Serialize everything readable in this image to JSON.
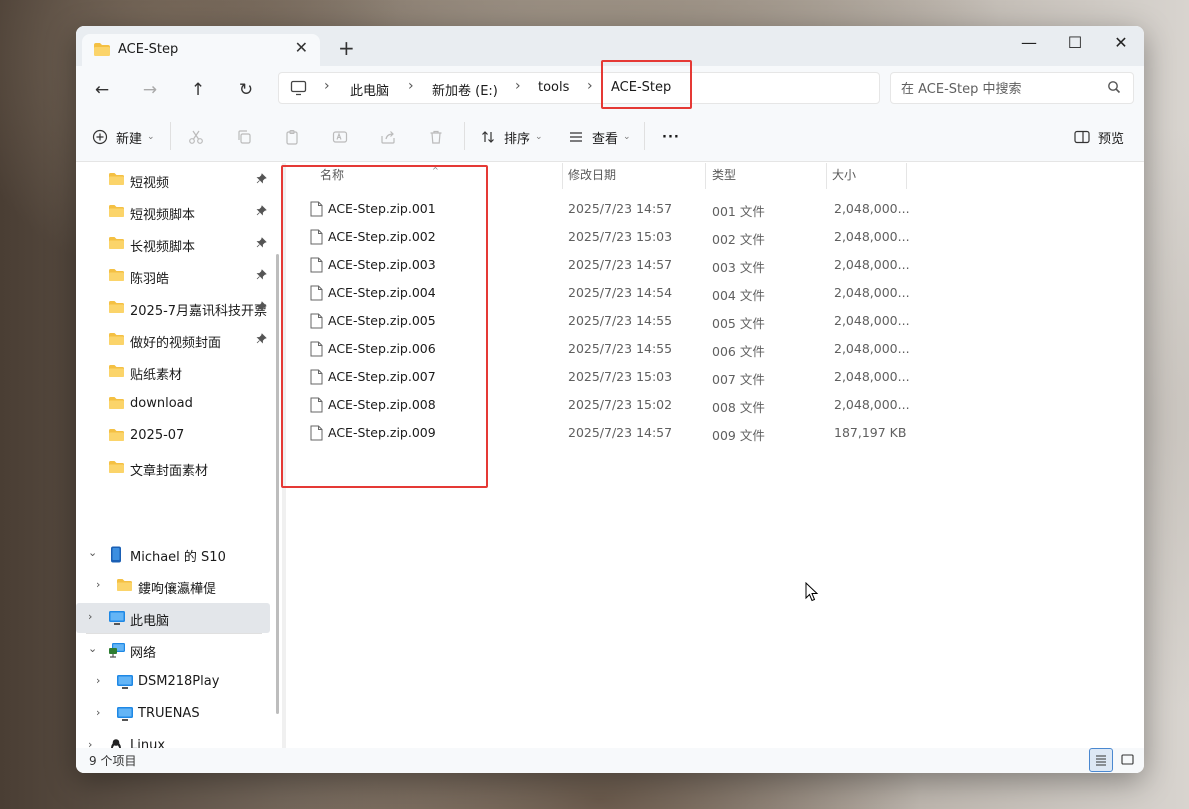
{
  "window": {
    "tab_title": "ACE-Step",
    "new_tab": "+",
    "close_tab": "✕",
    "minimize": "—",
    "maximize": "☐",
    "close": "✕"
  },
  "nav": {
    "back": "←",
    "forward": "→",
    "up": "↑",
    "refresh": "↻",
    "breadcrumb": [
      "此电脑",
      "新加卷 (E:)",
      "tools",
      "ACE-Step"
    ],
    "search_placeholder": "在 ACE-Step 中搜索"
  },
  "toolbar": {
    "new_label": "新建",
    "sort_label": "排序",
    "view_label": "查看",
    "more_label": "···",
    "preview_label": "预览"
  },
  "sidebar": {
    "quick_access": [
      {
        "label": "短视频",
        "pinned": true
      },
      {
        "label": "短视频脚本",
        "pinned": true
      },
      {
        "label": "长视频脚本",
        "pinned": true
      },
      {
        "label": "陈羽皓",
        "pinned": true
      },
      {
        "label": "2025-7月嘉讯科技开票",
        "pinned": true
      },
      {
        "label": "做好的视频封面",
        "pinned": true
      },
      {
        "label": "贴纸素材",
        "pinned": false
      },
      {
        "label": "download",
        "pinned": false
      },
      {
        "label": "2025-07",
        "pinned": false
      },
      {
        "label": "文章封面素材",
        "pinned": false
      }
    ],
    "device": "Michael 的 S10",
    "device_child": "鏤呴儴瀛樺偍",
    "this_pc": "此电脑",
    "network": "网络",
    "network_items": [
      "DSM218Play",
      "TRUENAS"
    ],
    "linux": "Linux"
  },
  "columns": {
    "name": "名称",
    "date": "修改日期",
    "type": "类型",
    "size": "大小"
  },
  "files": [
    {
      "name": "ACE-Step.zip.001",
      "date": "2025/7/23 14:57",
      "type": "001 文件",
      "size": "2,048,000..."
    },
    {
      "name": "ACE-Step.zip.002",
      "date": "2025/7/23 15:03",
      "type": "002 文件",
      "size": "2,048,000..."
    },
    {
      "name": "ACE-Step.zip.003",
      "date": "2025/7/23 14:57",
      "type": "003 文件",
      "size": "2,048,000..."
    },
    {
      "name": "ACE-Step.zip.004",
      "date": "2025/7/23 14:54",
      "type": "004 文件",
      "size": "2,048,000..."
    },
    {
      "name": "ACE-Step.zip.005",
      "date": "2025/7/23 14:55",
      "type": "005 文件",
      "size": "2,048,000..."
    },
    {
      "name": "ACE-Step.zip.006",
      "date": "2025/7/23 14:55",
      "type": "006 文件",
      "size": "2,048,000..."
    },
    {
      "name": "ACE-Step.zip.007",
      "date": "2025/7/23 15:03",
      "type": "007 文件",
      "size": "2,048,000..."
    },
    {
      "name": "ACE-Step.zip.008",
      "date": "2025/7/23 15:02",
      "type": "008 文件",
      "size": "2,048,000..."
    },
    {
      "name": "ACE-Step.zip.009",
      "date": "2025/7/23 14:57",
      "type": "009 文件",
      "size": "187,197 KB"
    }
  ],
  "status": {
    "item_count": "9 个项目"
  },
  "colors": {
    "highlight_box": "#e53935",
    "folder": "#f4c043",
    "selected_bg": "#e3e6ea"
  }
}
